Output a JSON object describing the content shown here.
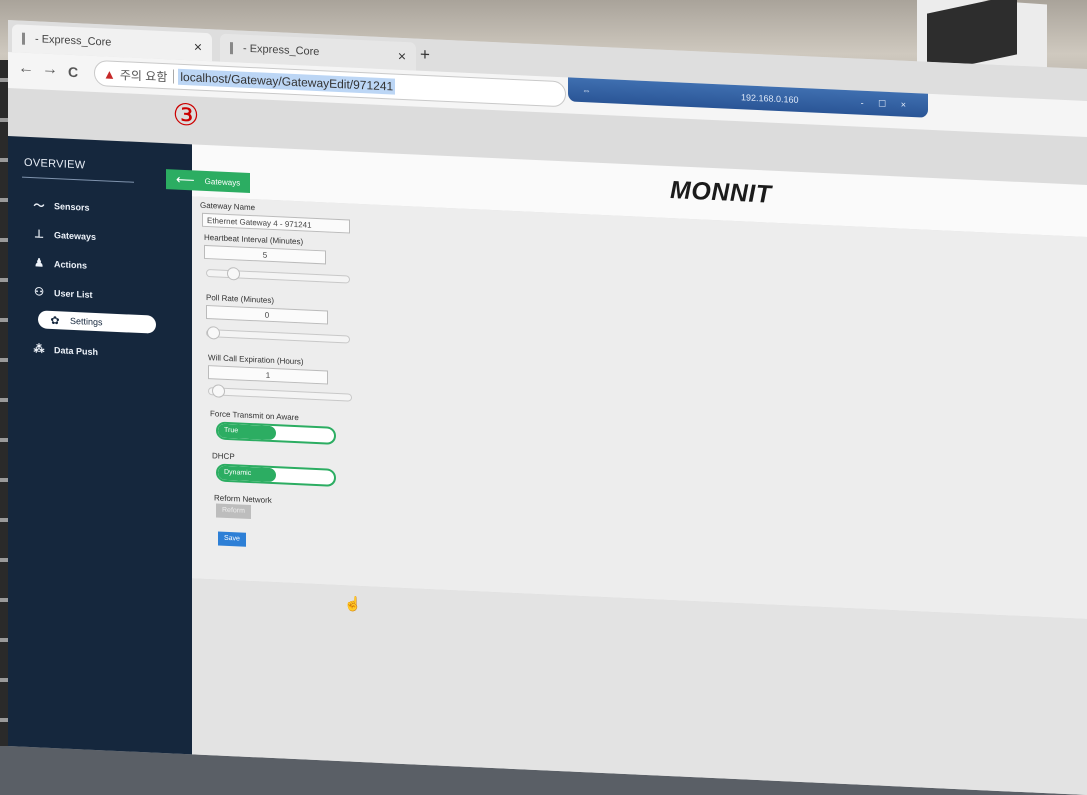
{
  "browser": {
    "tabs": [
      {
        "label": "- Express_Core"
      },
      {
        "label": "- Express_Core"
      }
    ],
    "new_tab": "+",
    "close": "×",
    "nav": {
      "back": "←",
      "forward": "→",
      "reload": "C"
    },
    "security_warning": "주의 요함",
    "url": "localhost/Gateway/GatewayEdit/971241",
    "annotation": "③"
  },
  "remote_session": {
    "address": "192.168.0.160",
    "controls": "- ☐ ×"
  },
  "sidebar": {
    "title": "OVERVIEW",
    "items": [
      {
        "label": "Sensors",
        "icon": "pulse-icon"
      },
      {
        "label": "Gateways",
        "icon": "gateway-icon"
      },
      {
        "label": "Actions",
        "icon": "actions-icon"
      },
      {
        "label": "User List",
        "icon": "users-icon"
      },
      {
        "label": "Settings",
        "icon": "gear-icon",
        "active": true
      },
      {
        "label": "Data Push",
        "icon": "data-push-icon"
      }
    ]
  },
  "header": {
    "back_label": "Gateways",
    "logo": "MONNIT"
  },
  "form": {
    "gateway_name": {
      "label": "Gateway Name",
      "value": "Ethernet Gateway 4 - 971241"
    },
    "heartbeat": {
      "label": "Heartbeat Interval (Minutes)",
      "value": "5",
      "slider_fraction": 0.15
    },
    "poll_rate": {
      "label": "Poll Rate (Minutes)",
      "value": "0",
      "slider_fraction": 0.0
    },
    "will_call": {
      "label": "Will Call Expiration (Hours)",
      "value": "1",
      "slider_fraction": 0.02
    },
    "force_transmit": {
      "label": "Force Transmit on Aware",
      "state": "True"
    },
    "dhcp": {
      "label": "DHCP",
      "state": "Dynamic"
    },
    "reform": {
      "label": "Reform Network",
      "button": "Reform"
    },
    "save": "Save"
  },
  "colors": {
    "sidebar_bg": "#15273d",
    "accent_green": "#2cad62",
    "save_blue": "#2d7fd6",
    "warning_red": "#c62828"
  }
}
